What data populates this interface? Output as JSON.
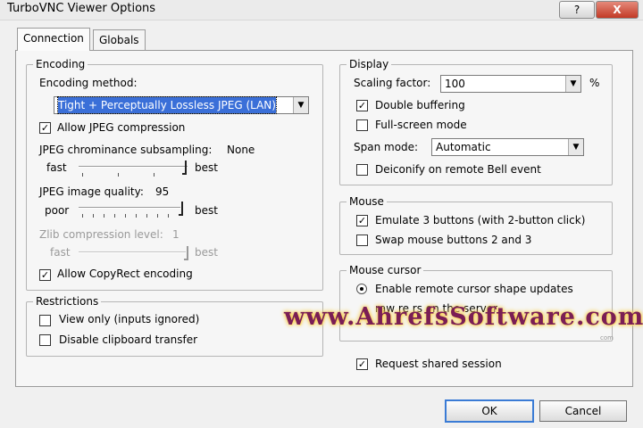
{
  "window": {
    "title": "TurboVNC Viewer Options",
    "help_label": "?",
    "close_label": "X"
  },
  "tabs": [
    {
      "label": "Connection",
      "active": true
    },
    {
      "label": "Globals",
      "active": false
    }
  ],
  "encoding": {
    "legend": "Encoding",
    "method_label": "Encoding method:",
    "method_value": "Tight + Perceptually Lossless JPEG (LAN)",
    "allow_jpeg_label": "Allow JPEG compression",
    "allow_jpeg_checked": true,
    "chroma_label": "JPEG chrominance subsampling:",
    "chroma_value": "None",
    "chroma_left": "fast",
    "chroma_right": "best",
    "quality_label": "JPEG image quality:",
    "quality_value": "95",
    "quality_left": "poor",
    "quality_right": "best",
    "zlib_label": "Zlib compression level:",
    "zlib_value": "1",
    "zlib_left": "fast",
    "zlib_right": "best",
    "copyrect_label": "Allow CopyRect encoding",
    "copyrect_checked": true
  },
  "restrictions": {
    "legend": "Restrictions",
    "view_only_label": "View only (inputs ignored)",
    "view_only_checked": false,
    "disable_clipboard_label": "Disable clipboard transfer",
    "disable_clipboard_checked": false
  },
  "display": {
    "legend": "Display",
    "scaling_label": "Scaling factor:",
    "scaling_value": "100",
    "scaling_unit": "%",
    "double_buffering_label": "Double buffering",
    "double_buffering_checked": true,
    "fullscreen_label": "Full-screen mode",
    "fullscreen_checked": false,
    "span_label": "Span mode:",
    "span_value": "Automatic",
    "deiconify_label": "Deiconify on remote Bell event",
    "deiconify_checked": false
  },
  "mouse": {
    "legend": "Mouse",
    "emulate_label": "Emulate 3 buttons (with 2-button click)",
    "emulate_checked": true,
    "swap_label": "Swap mouse buttons 2 and 3",
    "swap_checked": false
  },
  "mouse_cursor": {
    "legend": "Mouse cursor",
    "remote_shape_label": "Enable remote cursor shape updates",
    "remote_shape_selected": true,
    "draw_remote_label": "raw re   rs   on the server"
  },
  "request_shared_label": "Request shared session",
  "request_shared_checked": true,
  "buttons": {
    "ok": "OK",
    "cancel": "Cancel"
  },
  "watermark": "www.AhrefsSoftware.com",
  "watermark_small": "com",
  "icons": {
    "check": "checkmark-icon",
    "dropdown": "dropdown-arrow-icon",
    "radio": "radio-dot-icon"
  }
}
